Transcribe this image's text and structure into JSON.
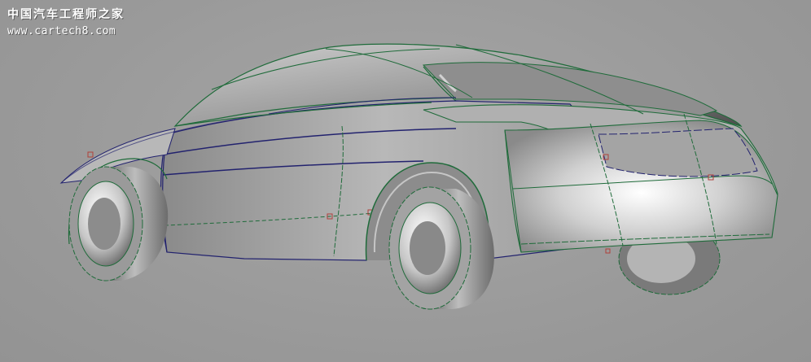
{
  "watermark": {
    "title": "中国汽车工程师之家",
    "url": "www.cartech8.com"
  },
  "viewport": {
    "subject": "3D surface model of a sedan (rear three-quarter view)",
    "background_color": "#9c9c9c",
    "wireframe_colors": {
      "edge": "#1f6b3a",
      "curve": "#22226e",
      "control_point": "#b0403a"
    }
  }
}
